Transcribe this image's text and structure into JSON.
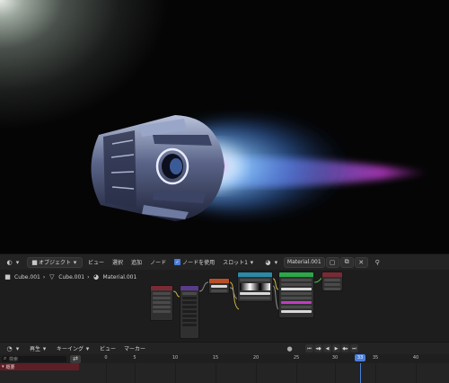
{
  "node_header": {
    "mode_label": "オブジェクト",
    "menus": [
      "ビュー",
      "選択",
      "追加",
      "ノード"
    ],
    "use_nodes_label": "ノードを使用",
    "slot_label": "スロット1",
    "material_name": "Material.001"
  },
  "breadcrumb": {
    "object": "Cube.001",
    "mesh": "Cube.001",
    "material": "Material.001"
  },
  "timeline_header": {
    "menus": [
      "再生",
      "キーイング",
      "ビュー",
      "マーカー"
    ]
  },
  "timeline": {
    "search_placeholder": "検索",
    "summary_label": "概要",
    "frame_ticks": [
      "0",
      "5",
      "10",
      "15",
      "20",
      "25",
      "30",
      "35",
      "40"
    ],
    "current_frame": "33"
  },
  "colors": {
    "accent": "#4a7ed9",
    "summary_bg": "#5c1f25",
    "flame_blue": "#5aa8ff",
    "flame_magenta": "#d040e0"
  }
}
